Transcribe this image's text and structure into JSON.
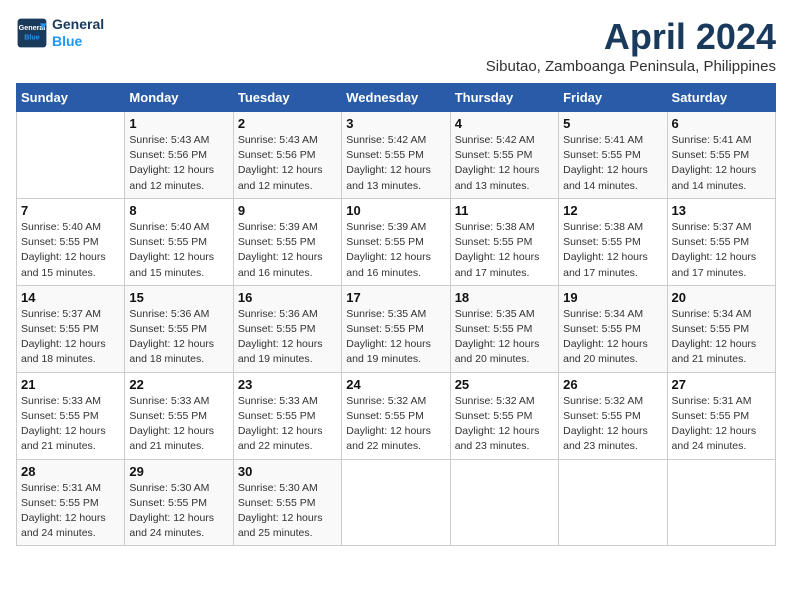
{
  "header": {
    "logo_line1": "General",
    "logo_line2": "Blue",
    "main_title": "April 2024",
    "subtitle": "Sibutao, Zamboanga Peninsula, Philippines"
  },
  "calendar": {
    "days_of_week": [
      "Sunday",
      "Monday",
      "Tuesday",
      "Wednesday",
      "Thursday",
      "Friday",
      "Saturday"
    ],
    "weeks": [
      [
        {
          "day": "",
          "info": ""
        },
        {
          "day": "1",
          "info": "Sunrise: 5:43 AM\nSunset: 5:56 PM\nDaylight: 12 hours\nand 12 minutes."
        },
        {
          "day": "2",
          "info": "Sunrise: 5:43 AM\nSunset: 5:56 PM\nDaylight: 12 hours\nand 12 minutes."
        },
        {
          "day": "3",
          "info": "Sunrise: 5:42 AM\nSunset: 5:55 PM\nDaylight: 12 hours\nand 13 minutes."
        },
        {
          "day": "4",
          "info": "Sunrise: 5:42 AM\nSunset: 5:55 PM\nDaylight: 12 hours\nand 13 minutes."
        },
        {
          "day": "5",
          "info": "Sunrise: 5:41 AM\nSunset: 5:55 PM\nDaylight: 12 hours\nand 14 minutes."
        },
        {
          "day": "6",
          "info": "Sunrise: 5:41 AM\nSunset: 5:55 PM\nDaylight: 12 hours\nand 14 minutes."
        }
      ],
      [
        {
          "day": "7",
          "info": "Sunrise: 5:40 AM\nSunset: 5:55 PM\nDaylight: 12 hours\nand 15 minutes."
        },
        {
          "day": "8",
          "info": "Sunrise: 5:40 AM\nSunset: 5:55 PM\nDaylight: 12 hours\nand 15 minutes."
        },
        {
          "day": "9",
          "info": "Sunrise: 5:39 AM\nSunset: 5:55 PM\nDaylight: 12 hours\nand 16 minutes."
        },
        {
          "day": "10",
          "info": "Sunrise: 5:39 AM\nSunset: 5:55 PM\nDaylight: 12 hours\nand 16 minutes."
        },
        {
          "day": "11",
          "info": "Sunrise: 5:38 AM\nSunset: 5:55 PM\nDaylight: 12 hours\nand 17 minutes."
        },
        {
          "day": "12",
          "info": "Sunrise: 5:38 AM\nSunset: 5:55 PM\nDaylight: 12 hours\nand 17 minutes."
        },
        {
          "day": "13",
          "info": "Sunrise: 5:37 AM\nSunset: 5:55 PM\nDaylight: 12 hours\nand 17 minutes."
        }
      ],
      [
        {
          "day": "14",
          "info": "Sunrise: 5:37 AM\nSunset: 5:55 PM\nDaylight: 12 hours\nand 18 minutes."
        },
        {
          "day": "15",
          "info": "Sunrise: 5:36 AM\nSunset: 5:55 PM\nDaylight: 12 hours\nand 18 minutes."
        },
        {
          "day": "16",
          "info": "Sunrise: 5:36 AM\nSunset: 5:55 PM\nDaylight: 12 hours\nand 19 minutes."
        },
        {
          "day": "17",
          "info": "Sunrise: 5:35 AM\nSunset: 5:55 PM\nDaylight: 12 hours\nand 19 minutes."
        },
        {
          "day": "18",
          "info": "Sunrise: 5:35 AM\nSunset: 5:55 PM\nDaylight: 12 hours\nand 20 minutes."
        },
        {
          "day": "19",
          "info": "Sunrise: 5:34 AM\nSunset: 5:55 PM\nDaylight: 12 hours\nand 20 minutes."
        },
        {
          "day": "20",
          "info": "Sunrise: 5:34 AM\nSunset: 5:55 PM\nDaylight: 12 hours\nand 21 minutes."
        }
      ],
      [
        {
          "day": "21",
          "info": "Sunrise: 5:33 AM\nSunset: 5:55 PM\nDaylight: 12 hours\nand 21 minutes."
        },
        {
          "day": "22",
          "info": "Sunrise: 5:33 AM\nSunset: 5:55 PM\nDaylight: 12 hours\nand 21 minutes."
        },
        {
          "day": "23",
          "info": "Sunrise: 5:33 AM\nSunset: 5:55 PM\nDaylight: 12 hours\nand 22 minutes."
        },
        {
          "day": "24",
          "info": "Sunrise: 5:32 AM\nSunset: 5:55 PM\nDaylight: 12 hours\nand 22 minutes."
        },
        {
          "day": "25",
          "info": "Sunrise: 5:32 AM\nSunset: 5:55 PM\nDaylight: 12 hours\nand 23 minutes."
        },
        {
          "day": "26",
          "info": "Sunrise: 5:32 AM\nSunset: 5:55 PM\nDaylight: 12 hours\nand 23 minutes."
        },
        {
          "day": "27",
          "info": "Sunrise: 5:31 AM\nSunset: 5:55 PM\nDaylight: 12 hours\nand 24 minutes."
        }
      ],
      [
        {
          "day": "28",
          "info": "Sunrise: 5:31 AM\nSunset: 5:55 PM\nDaylight: 12 hours\nand 24 minutes."
        },
        {
          "day": "29",
          "info": "Sunrise: 5:30 AM\nSunset: 5:55 PM\nDaylight: 12 hours\nand 24 minutes."
        },
        {
          "day": "30",
          "info": "Sunrise: 5:30 AM\nSunset: 5:55 PM\nDaylight: 12 hours\nand 25 minutes."
        },
        {
          "day": "",
          "info": ""
        },
        {
          "day": "",
          "info": ""
        },
        {
          "day": "",
          "info": ""
        },
        {
          "day": "",
          "info": ""
        }
      ]
    ]
  }
}
